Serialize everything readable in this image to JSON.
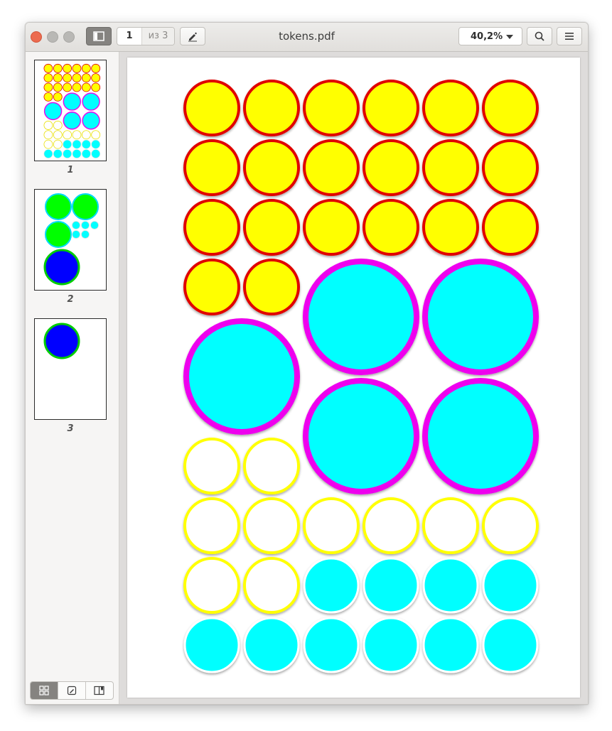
{
  "window": {
    "title": "tokens.pdf",
    "page_current": "1",
    "page_of": "из 3",
    "zoom": "40,2%"
  },
  "toolbar": {
    "sidebar_toggle_icon": "sidebar-icon",
    "annotate_icon": "pencil-icon",
    "search_icon": "search-icon",
    "menu_icon": "hamburger-icon"
  },
  "sidebar": {
    "thumbnails": [
      {
        "label": "1"
      },
      {
        "label": "2"
      },
      {
        "label": "3"
      }
    ],
    "modes": [
      "thumbnails-icon",
      "annotations-icon",
      "bookmarks-icon"
    ]
  },
  "colors": {
    "yellow": "#ffff00",
    "red": "#e00000",
    "cyan": "#00ffff",
    "magenta": "#ee00ee",
    "green": "#00ff00",
    "blue": "#0000ff",
    "accent": "#ec6b4f"
  }
}
